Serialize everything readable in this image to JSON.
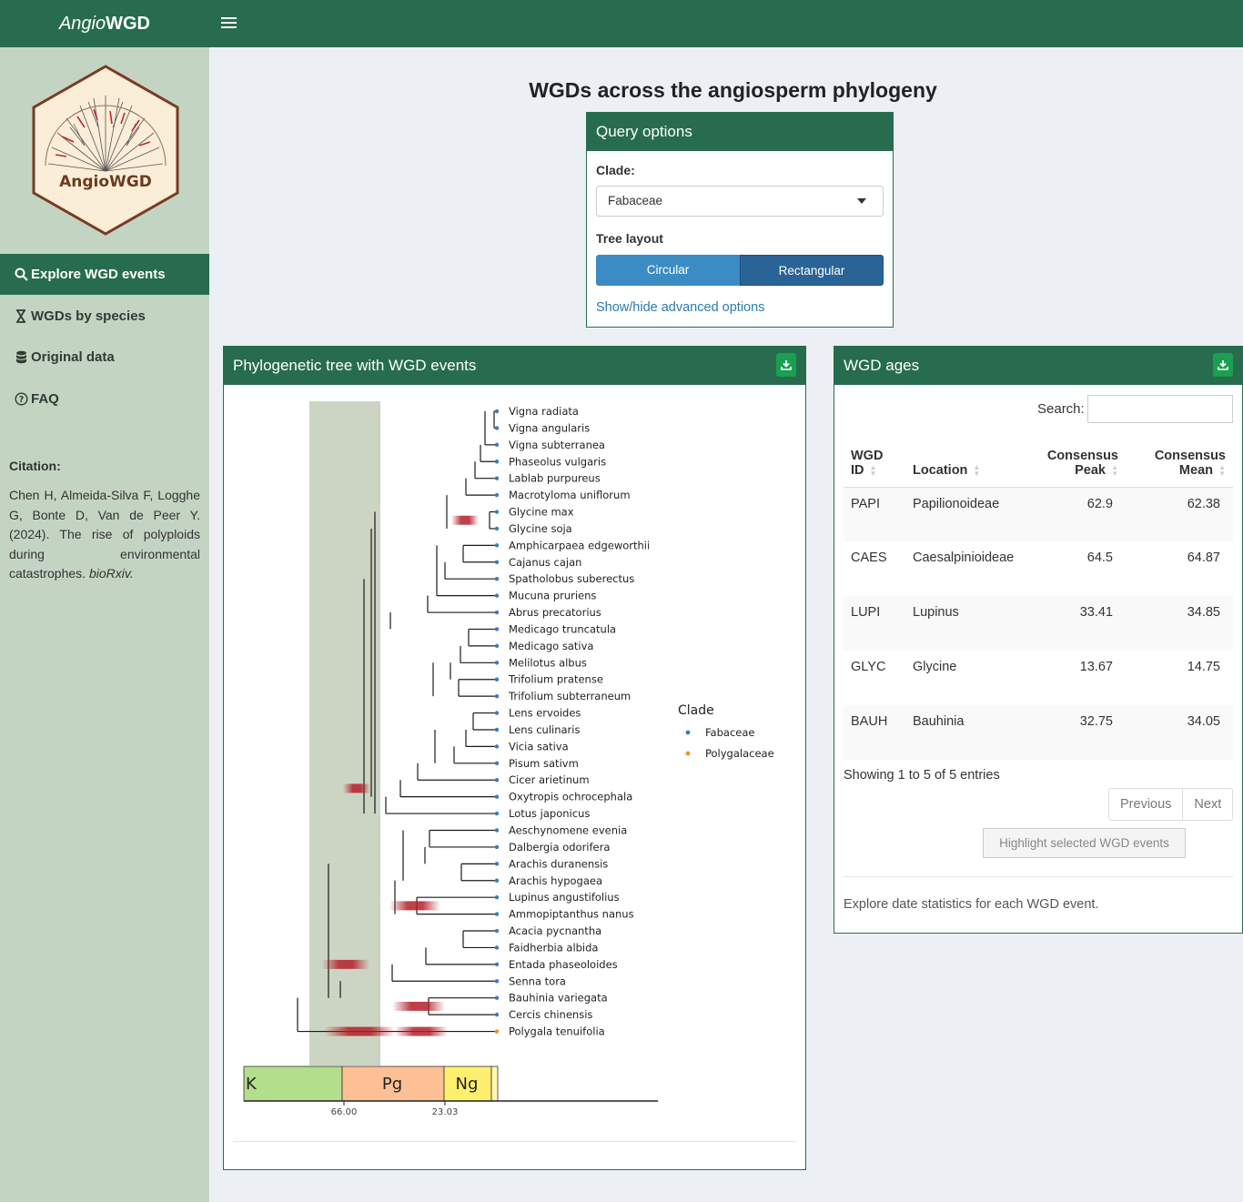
{
  "header": {
    "brand_italic": "Angio",
    "brand_bold": "WGD"
  },
  "sidebar": {
    "logo_text": "AngioWGD",
    "items": [
      {
        "label": "Explore WGD events",
        "icon": "search-icon",
        "active": true
      },
      {
        "label": "WGDs by species",
        "icon": "hourglass-icon",
        "active": false
      },
      {
        "label": "Original data",
        "icon": "database-icon",
        "active": false
      },
      {
        "label": "FAQ",
        "icon": "question-circle-icon",
        "active": false
      }
    ],
    "citation_title": "Citation:",
    "citation_text": "Chen H, Almeida-Silva F, Logghe G, Bonte D, Van de Peer Y. (2024). The rise of polyploids during environmental catastrophes.",
    "citation_journal": "bioRxiv."
  },
  "page_title": "WGDs across the angiosperm phylogeny",
  "query": {
    "title": "Query options",
    "clade_label": "Clade:",
    "clade_value": "Fabaceae",
    "layout_label": "Tree layout",
    "layout_options": [
      "Circular",
      "Rectangular"
    ],
    "layout_selected": "Rectangular",
    "advanced_link": "Show/hide advanced options"
  },
  "tree_panel": {
    "title": "Phylogenetic tree with WGD events",
    "legend_title": "Clade",
    "legend": [
      {
        "name": "Fabaceae",
        "color": "#3a7cc1"
      },
      {
        "name": "Polygalaceae",
        "color": "#f08c2b"
      }
    ],
    "species": [
      "Vigna radiata",
      "Vigna angularis",
      "Vigna subterranea",
      "Phaseolus vulgaris",
      "Lablab purpureus",
      "Macrotyloma uniflorum",
      "Glycine max",
      "Glycine soja",
      "Amphicarpaea edgeworthii",
      "Cajanus cajan",
      "Spatholobus suberectus",
      "Mucuna pruriens",
      "Abrus precatorius",
      "Medicago truncatula",
      "Medicago sativa",
      "Melilotus albus",
      "Trifolium pratense",
      "Trifolium subterraneum",
      "Lens ervoides",
      "Lens culinaris",
      "Vicia sativa",
      "Pisum sativm",
      "Cicer arietinum",
      "Oxytropis ochrocephala",
      "Lotus japonicus",
      "Aeschynomene evenia",
      "Dalbergia odorifera",
      "Arachis duranensis",
      "Arachis hypogaea",
      "Lupinus angustifolius",
      "Ammopiptanthus nanus",
      "Acacia pycnantha",
      "Faidherbia albida",
      "Entada phaseoloides",
      "Senna tora",
      "Bauhinia variegata",
      "Cercis chinensis",
      "Polygala tenuifolia"
    ],
    "geo_periods": [
      {
        "label": "K",
        "color": "#b3de8c"
      },
      {
        "label": "Pg",
        "color": "#fdc095"
      },
      {
        "label": "Ng",
        "color": "#ffef6e"
      }
    ],
    "axis_ticks": [
      "66.00",
      "23.03"
    ]
  },
  "ages_panel": {
    "title": "WGD ages",
    "search_label": "Search:",
    "search_value": "",
    "columns": [
      "WGD ID",
      "Location",
      "Consensus Peak",
      "Consensus Mean"
    ],
    "rows": [
      [
        "PAPI",
        "Papilionoideae",
        "62.9",
        "62.38"
      ],
      [
        "CAES",
        "Caesalpinioideae",
        "64.5",
        "64.87"
      ],
      [
        "LUPI",
        "Lupinus",
        "33.41",
        "34.85"
      ],
      [
        "GLYC",
        "Glycine",
        "13.67",
        "14.75"
      ],
      [
        "BAUH",
        "Bauhinia",
        "32.75",
        "34.05"
      ]
    ],
    "info": "Showing 1 to 5 of 5 entries",
    "prev_label": "Previous",
    "next_label": "Next",
    "highlight_label": "Highlight selected WGD events",
    "footer": "Explore date statistics for each WGD event."
  }
}
